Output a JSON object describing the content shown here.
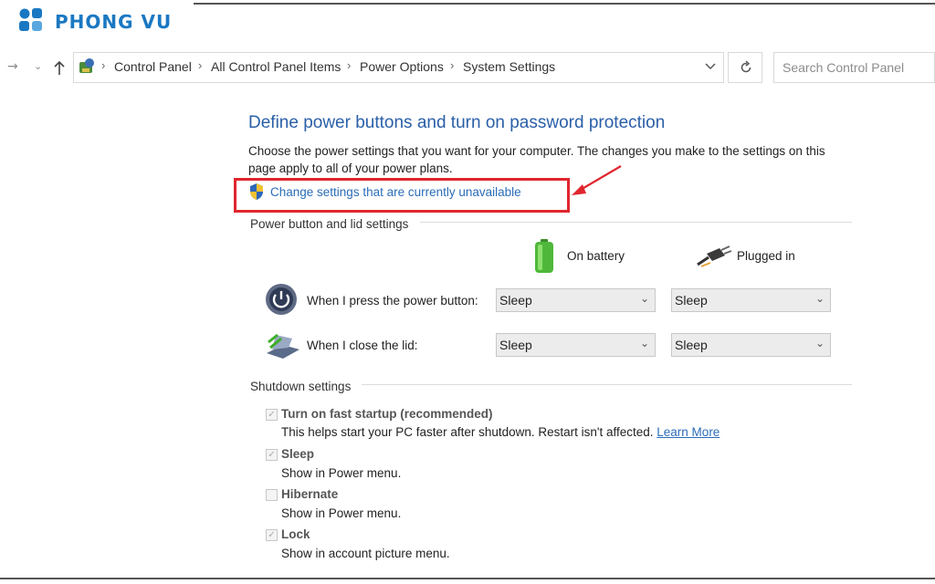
{
  "logo": {
    "text": "PHONG VU",
    "color": "#1a78c2"
  },
  "nav": {
    "forward_icon": "forward-arrow-icon",
    "history_icon": "chevron-down-icon",
    "up_icon": "up-arrow-icon"
  },
  "breadcrumb": [
    "Control Panel",
    "All Control Panel Items",
    "Power Options",
    "System Settings"
  ],
  "search": {
    "placeholder": "Search Control Panel"
  },
  "page": {
    "title": "Define power buttons and turn on password protection",
    "description_line1": "Choose the power settings that you want for your computer. The changes you make to the settings on this",
    "description_line2": "page apply to all of your power plans.",
    "change_settings_link": "Change settings that are currently unavailable"
  },
  "power_section": {
    "heading": "Power button and lid settings",
    "col_battery": "On battery",
    "col_plugged": "Plugged in",
    "rows": [
      {
        "label": "When I press the power button:",
        "battery": "Sleep",
        "plugged": "Sleep"
      },
      {
        "label": "When I close the lid:",
        "battery": "Sleep",
        "plugged": "Sleep"
      }
    ]
  },
  "shutdown_section": {
    "heading": "Shutdown settings",
    "options": [
      {
        "title": "Turn on fast startup (recommended)",
        "desc": "This helps start your PC faster after shutdown. Restart isn't affected.",
        "link": "Learn More",
        "checked": true
      },
      {
        "title": "Sleep",
        "desc": "Show in Power menu.",
        "checked": true
      },
      {
        "title": "Hibernate",
        "desc": "Show in Power menu.",
        "checked": false
      },
      {
        "title": "Lock",
        "desc": "Show in account picture menu.",
        "checked": true
      }
    ]
  },
  "colors": {
    "accent_link": "#2a6cb8",
    "title_blue": "#2a5fa8",
    "highlight_red": "#e0262e"
  }
}
